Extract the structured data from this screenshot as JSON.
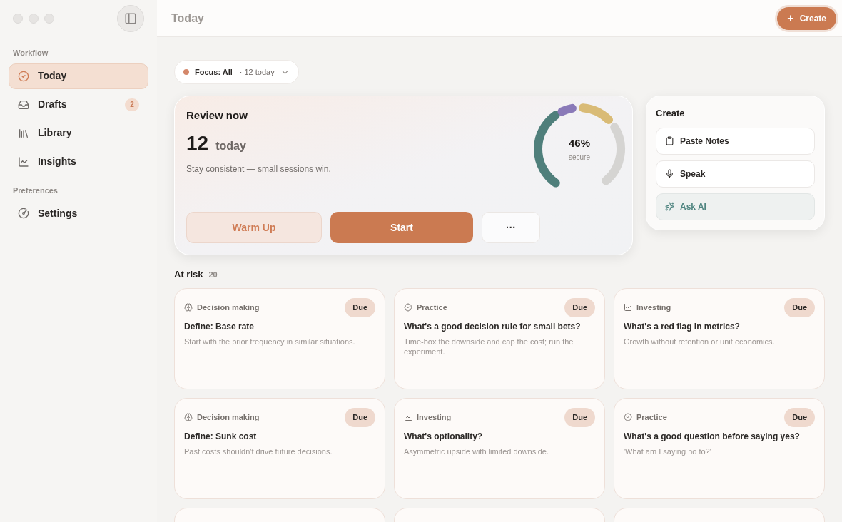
{
  "sidebar": {
    "sections": [
      {
        "title": "Workflow",
        "items": [
          {
            "label": "Today",
            "kind": "today",
            "selected": true
          },
          {
            "label": "Drafts",
            "kind": "drafts",
            "selected": false,
            "badge": "2"
          },
          {
            "label": "Library",
            "kind": "library",
            "selected": false
          },
          {
            "label": "Insights",
            "kind": "insights",
            "selected": false
          }
        ]
      },
      {
        "title": "Preferences",
        "items": [
          {
            "label": "Settings",
            "kind": "settings",
            "selected": false
          }
        ]
      }
    ]
  },
  "header": {
    "title": "Today",
    "create_button": "Create",
    "create_icon": "+"
  },
  "focus": {
    "label": "Focus: All",
    "count": "· 12 today"
  },
  "review": {
    "title": "Review now",
    "count": "12",
    "unit": "today",
    "subtitle": "Stay consistent — small sessions win.",
    "gauge_value": "46%",
    "gauge_label": "secure",
    "buttons": [
      {
        "label": "Warm Up",
        "kind": "secondary"
      },
      {
        "label": "Start",
        "kind": "primary"
      },
      {
        "label": "···",
        "kind": "more"
      }
    ]
  },
  "create_panel": {
    "title": "Create",
    "items": [
      {
        "label": "Paste Notes",
        "kind": "paste"
      },
      {
        "label": "Speak",
        "kind": "speak"
      },
      {
        "label": "Ask AI",
        "kind": "ai"
      }
    ]
  },
  "at_risk": {
    "title": "At risk",
    "count": "20",
    "cards": [
      {
        "kind": "decision",
        "category": "Decision making",
        "badge": "Due",
        "title": "Define: Base rate",
        "text": "Start with the prior frequency in similar situations."
      },
      {
        "kind": "practice",
        "category": "Practice",
        "badge": "Due",
        "title": "What's a good decision rule for small bets?",
        "text": "Time-box the downside and cap the cost; run the experiment."
      },
      {
        "kind": "investing",
        "category": "Investing",
        "badge": "Due",
        "title": "What's a red flag in metrics?",
        "text": "Growth without retention or unit economics."
      },
      {
        "kind": "decision",
        "category": "Decision making",
        "badge": "Due",
        "title": "Define: Sunk cost",
        "text": "Past costs shouldn't drive future decisions."
      },
      {
        "kind": "investing",
        "category": "Investing",
        "badge": "Due",
        "title": "What's optionality?",
        "text": "Asymmetric upside with limited downside."
      },
      {
        "kind": "practice",
        "category": "Practice",
        "badge": "Due",
        "title": "What's a good question before saying yes?",
        "text": "'What am I saying no to?'"
      }
    ]
  }
}
